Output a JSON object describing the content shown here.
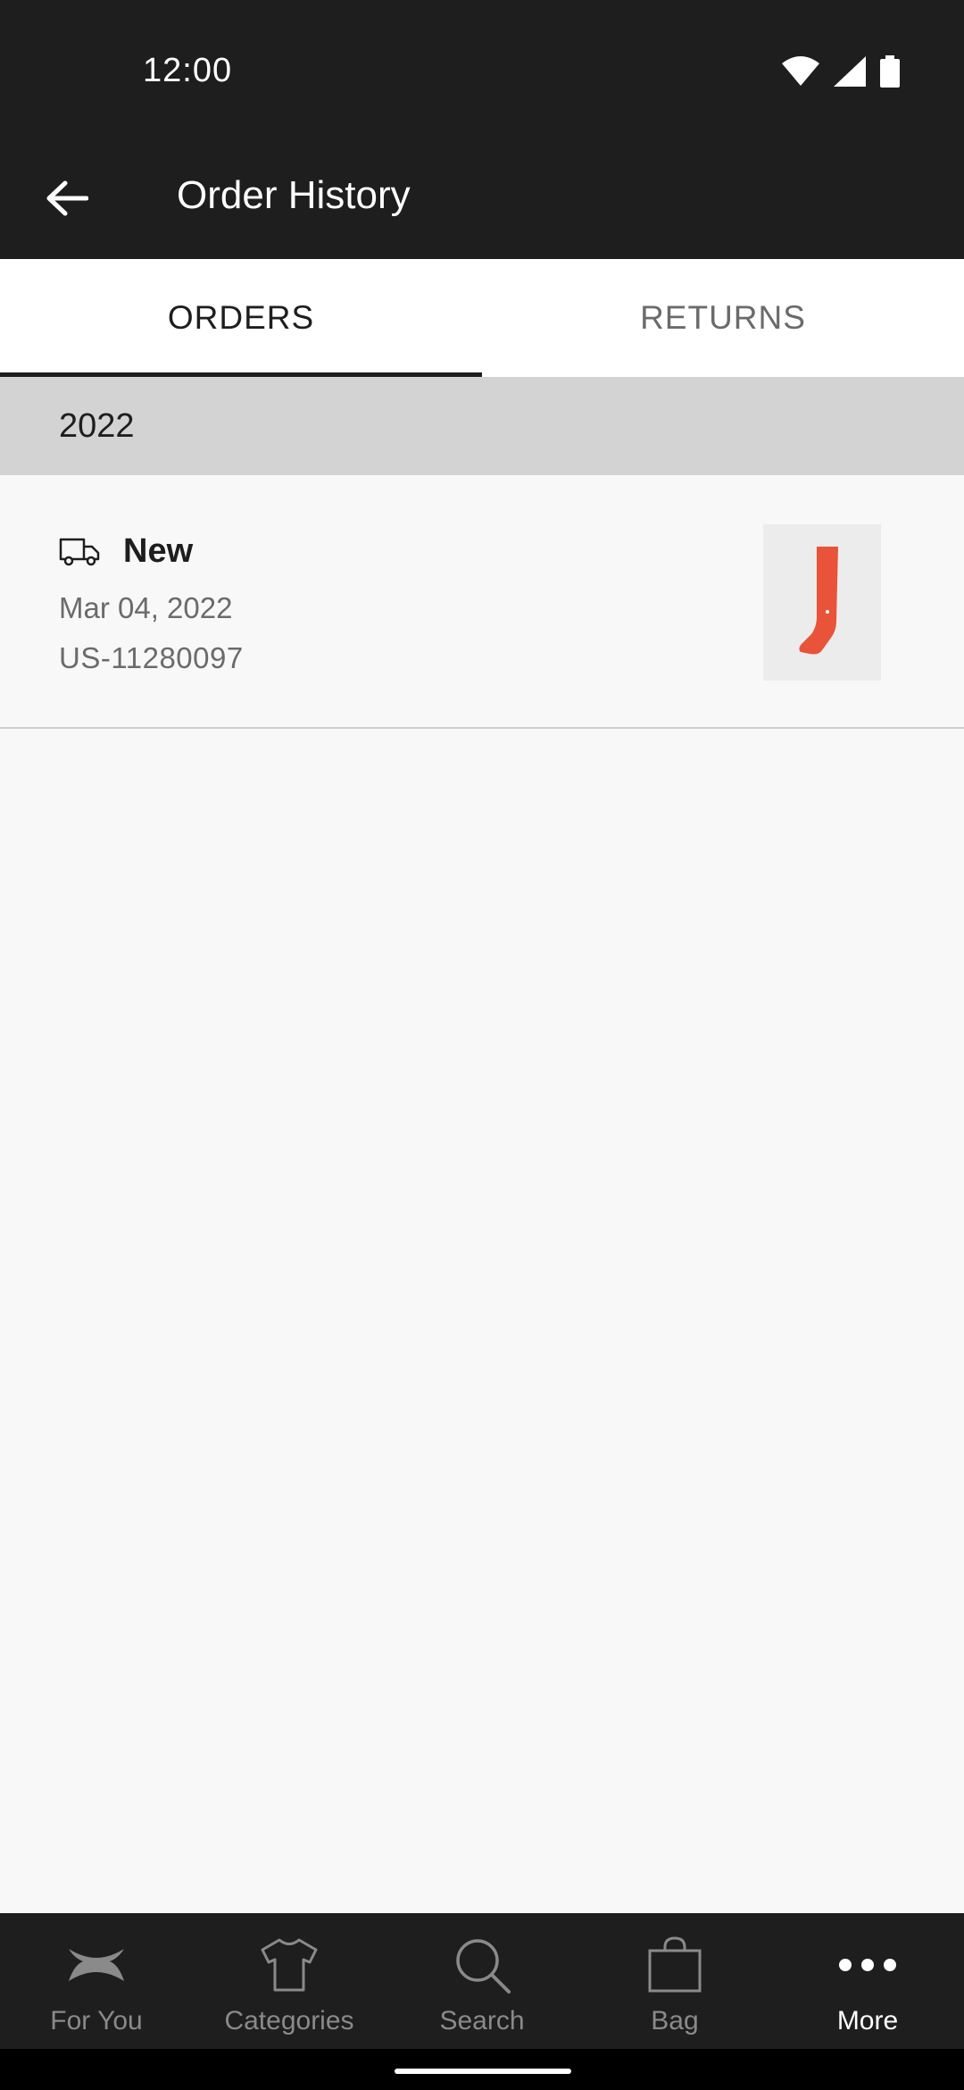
{
  "status_bar": {
    "time": "12:00",
    "icons": [
      "wifi-icon",
      "cell-signal-icon",
      "battery-icon"
    ]
  },
  "app_bar": {
    "title": "Order History",
    "back_icon": "arrow-left-icon"
  },
  "tabs": [
    {
      "label": "ORDERS",
      "active": true
    },
    {
      "label": "RETURNS",
      "active": false
    }
  ],
  "orders": {
    "year": "2022",
    "items": [
      {
        "status": "New",
        "status_icon": "truck-icon",
        "date": "Mar 04, 2022",
        "order_number": "US-11280097",
        "thumbnail": "red-sock-image"
      }
    ]
  },
  "bottom_nav": [
    {
      "label": "For You",
      "icon": "brand-logo-icon",
      "active": false
    },
    {
      "label": "Categories",
      "icon": "shirt-icon",
      "active": false
    },
    {
      "label": "Search",
      "icon": "search-icon",
      "active": false
    },
    {
      "label": "Bag",
      "icon": "bag-icon",
      "active": false
    },
    {
      "label": "More",
      "icon": "more-dots-icon",
      "active": true
    }
  ],
  "colors": {
    "bar": "#1e1e1e",
    "background": "#f8f8f8",
    "year_header": "#d3d3d3",
    "product": "#e8533a"
  }
}
